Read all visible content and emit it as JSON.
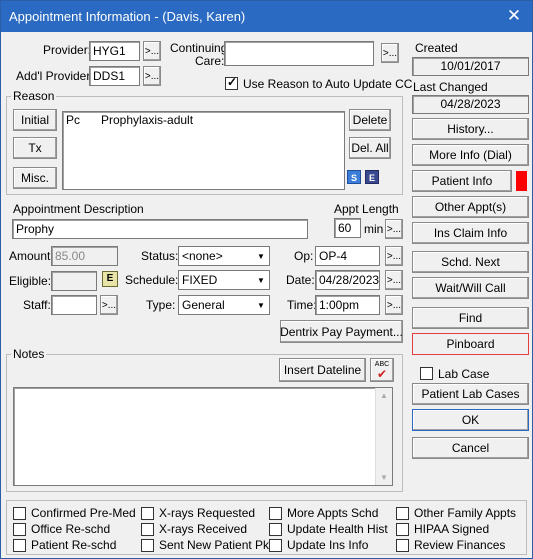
{
  "window": {
    "title": "Appointment Information - (Davis, Karen)",
    "close": "✕"
  },
  "provider": {
    "label": "Provider:",
    "value": "HYG1",
    "browse": ">..."
  },
  "addl_provider": {
    "label": "Add'l Provider:",
    "value": "DDS1",
    "browse": ">..."
  },
  "continuing_care": {
    "label1": "Continuing",
    "label2": "Care:",
    "value": "",
    "browse": ">..."
  },
  "use_reason": {
    "label": "Use Reason to Auto Update CC",
    "checked": true
  },
  "reason": {
    "group_title": "Reason",
    "initial": "Initial",
    "tx": "Tx",
    "misc": "Misc.",
    "delete": "Delete",
    "del_all": "Del. All",
    "items": [
      {
        "code": "Pc",
        "desc": "Prophylaxis-adult"
      }
    ],
    "icon_s": "S",
    "icon_e": "E"
  },
  "appt_desc": {
    "label": "Appointment Description",
    "value": "Prophy"
  },
  "appt_length": {
    "label": "Appt Length",
    "value": "60",
    "unit": "min",
    "browse": ">..."
  },
  "amount": {
    "label": "Amount:",
    "value": "85.00"
  },
  "eligible": {
    "label": "Eligible:",
    "value": "",
    "icon": "E"
  },
  "staff": {
    "label": "Staff:",
    "value": "",
    "browse": ">..."
  },
  "status": {
    "label": "Status:",
    "value": "<none>"
  },
  "schedule": {
    "label": "Schedule:",
    "value": "FIXED"
  },
  "type": {
    "label": "Type:",
    "value": "General"
  },
  "op": {
    "label": "Op:",
    "value": "OP-4",
    "browse": ">..."
  },
  "date": {
    "label": "Date:",
    "value": "04/28/2023",
    "browse": ">..."
  },
  "time": {
    "label": "Time:",
    "value": "1:00pm",
    "browse": ">..."
  },
  "dentrix_pay": "Dentrix Pay Payment...",
  "notes": {
    "group_title": "Notes",
    "insert_dateline": "Insert Dateline",
    "spell_label": "ABC",
    "value": ""
  },
  "side": {
    "created_label": "Created",
    "created": "10/01/2017",
    "last_changed_label": "Last Changed",
    "last_changed": "04/28/2023",
    "history": "History...",
    "more_info": "More Info (Dial)",
    "patient_info": "Patient Info",
    "patient_info_flag_color": "#ff0000",
    "other_appts": "Other Appt(s)",
    "ins_claim": "Ins Claim Info",
    "schd_next": "Schd. Next",
    "wait_will_call": "Wait/Will Call",
    "find": "Find",
    "pinboard": "Pinboard",
    "pinboard_border": "#e04040",
    "lab_case": "Lab Case",
    "patient_lab_cases": "Patient Lab Cases",
    "ok": "OK",
    "cancel": "Cancel"
  },
  "bottom_checks": [
    [
      "Confirmed Pre-Med",
      "X-rays Requested",
      "More Appts Schd",
      "Other Family Appts"
    ],
    [
      "Office Re-schd",
      "X-rays Received",
      "Update Health Hist",
      "HIPAA Signed"
    ],
    [
      "Patient Re-schd",
      "Sent New Patient Pkg",
      "Update Ins Info",
      "Review Finances"
    ]
  ]
}
